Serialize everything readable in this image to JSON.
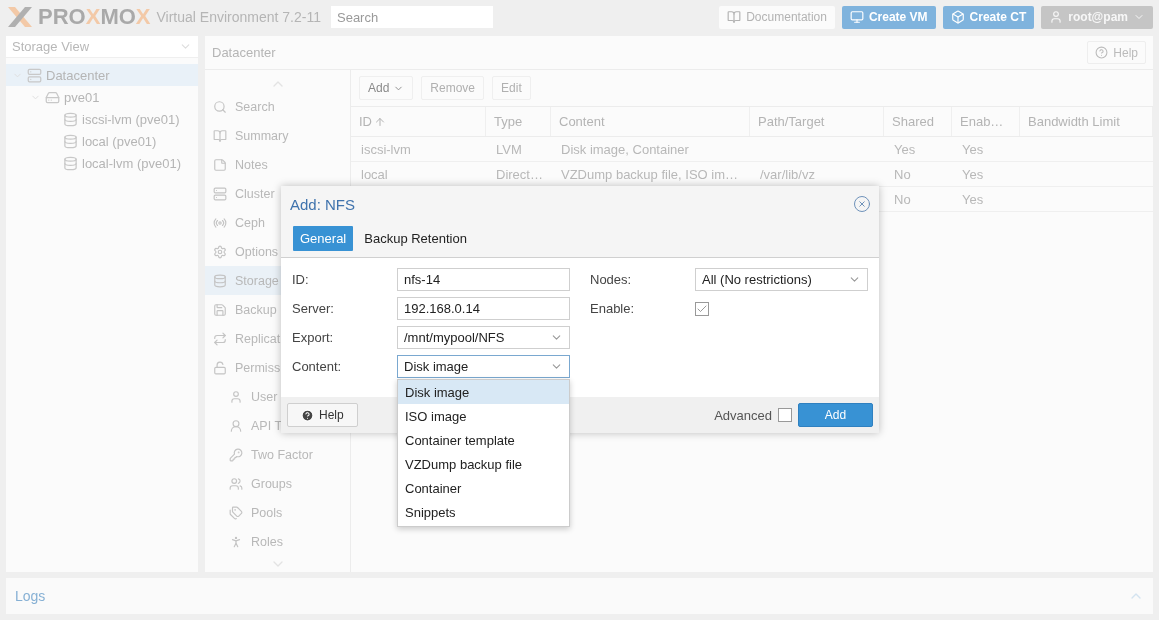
{
  "topbar": {
    "logo": [
      {
        "text": "PRO",
        "accent": false
      },
      {
        "text": "X",
        "accent": true
      },
      {
        "text": "MO",
        "accent": false
      },
      {
        "text": "X",
        "accent": true
      }
    ],
    "product": "Virtual Environment 7.2-11",
    "search": {
      "placeholder": "Search"
    },
    "buttons": [
      {
        "label": "Documentation",
        "kind": "plain"
      },
      {
        "label": "Create VM",
        "kind": "primary"
      },
      {
        "label": "Create CT",
        "kind": "primary"
      },
      {
        "label": "root@pam",
        "kind": "user"
      }
    ]
  },
  "sidebar": {
    "view": "Storage View",
    "tree": [
      {
        "label": "Datacenter",
        "selected": true,
        "expanded": true,
        "children": [
          {
            "label": "pve01",
            "selected": false,
            "expanded": true,
            "children": [
              {
                "label": "iscsi-lvm (pve01)",
                "selected": false
              },
              {
                "label": "local (pve01)",
                "selected": false
              },
              {
                "label": "local-lvm (pve01)",
                "selected": false
              }
            ]
          }
        ]
      }
    ]
  },
  "main": {
    "title": "Datacenter",
    "help": "Help",
    "nav": [
      {
        "label": "Search",
        "selected": false
      },
      {
        "label": "Summary",
        "selected": false
      },
      {
        "label": "Notes",
        "selected": false
      },
      {
        "label": "Cluster",
        "selected": false
      },
      {
        "label": "Ceph",
        "selected": false
      },
      {
        "label": "Options",
        "selected": false
      },
      {
        "label": "Storage",
        "selected": true
      },
      {
        "label": "Backup",
        "selected": false
      },
      {
        "label": "Replicat",
        "selected": false
      },
      {
        "label": "Permiss",
        "selected": false,
        "children": [
          {
            "label": "User",
            "selected": false
          },
          {
            "label": "API T",
            "selected": false
          },
          {
            "label": "Two Factor",
            "selected": false
          },
          {
            "label": "Groups",
            "selected": false
          },
          {
            "label": "Pools",
            "selected": false
          },
          {
            "label": "Roles",
            "selected": false
          }
        ]
      }
    ],
    "toolbar": [
      {
        "label": "Add",
        "disabled": false,
        "menu": true
      },
      {
        "label": "Remove",
        "disabled": true,
        "menu": false
      },
      {
        "label": "Edit",
        "disabled": true,
        "menu": false
      }
    ],
    "table": {
      "columns": [
        {
          "label": "ID",
          "sorted": true
        },
        {
          "label": "Type",
          "sorted": false
        },
        {
          "label": "Content",
          "sorted": false
        },
        {
          "label": "Path/Target",
          "sorted": false
        },
        {
          "label": "Shared",
          "sorted": false
        },
        {
          "label": "Enab…",
          "sorted": false
        },
        {
          "label": "Bandwidth Limit",
          "sorted": false
        }
      ],
      "rows": [
        {
          "cells": [
            "iscsi-lvm",
            "LVM",
            "Disk image, Container",
            "",
            "Yes",
            "Yes",
            ""
          ]
        },
        {
          "cells": [
            "local",
            "Direct…",
            "VZDump backup file, ISO im…",
            "/var/lib/vz",
            "No",
            "Yes",
            ""
          ]
        },
        {
          "cells": [
            "",
            "",
            "",
            "",
            "No",
            "Yes",
            ""
          ]
        }
      ]
    }
  },
  "dialog": {
    "title": "Add: NFS",
    "tabs": [
      {
        "label": "General",
        "selected": true
      },
      {
        "label": "Backup Retention",
        "selected": false
      }
    ],
    "left_fields": [
      {
        "label": "ID:",
        "kind": "text",
        "value": "nfs-14"
      },
      {
        "label": "Server:",
        "kind": "text",
        "value": "192.168.0.14"
      },
      {
        "label": "Export:",
        "kind": "combo",
        "value": "/mnt/mypool/NFS",
        "expanded": false
      },
      {
        "label": "Content:",
        "kind": "combo",
        "value": "Disk image",
        "expanded": true,
        "options": [
          {
            "label": "Disk image",
            "selected": true
          },
          {
            "label": "ISO image",
            "selected": false
          },
          {
            "label": "Container template",
            "selected": false
          },
          {
            "label": "VZDump backup file",
            "selected": false
          },
          {
            "label": "Container",
            "selected": false
          },
          {
            "label": "Snippets",
            "selected": false
          }
        ]
      }
    ],
    "right_fields": [
      {
        "label": "Nodes:",
        "kind": "combo",
        "value": "All (No restrictions)",
        "expanded": false
      },
      {
        "label": "Enable:",
        "kind": "checkbox",
        "checked": true
      }
    ],
    "help": "Help",
    "advanced": {
      "label": "Advanced",
      "checked": false
    },
    "submit": "Add"
  },
  "logs": {
    "title": "Logs"
  }
}
